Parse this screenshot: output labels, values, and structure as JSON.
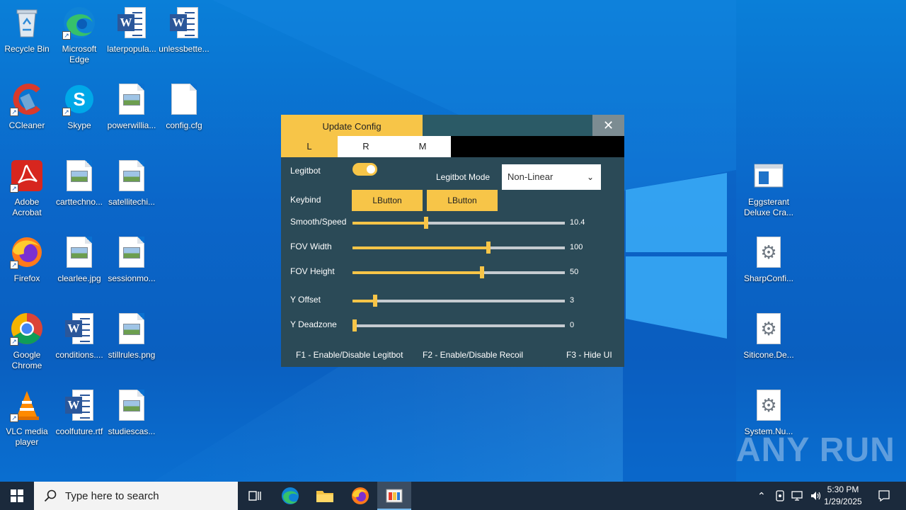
{
  "desktop": {
    "icons_left": [
      {
        "label": "Recycle Bin",
        "icon": "recycle-bin-icon"
      },
      {
        "label": "Microsoft Edge",
        "icon": "edge-icon"
      },
      {
        "label": "laterpopula...",
        "icon": "word-doc-icon"
      },
      {
        "label": "unlessbette...",
        "icon": "word-doc-icon"
      },
      {
        "label": "CCleaner",
        "icon": "ccleaner-icon"
      },
      {
        "label": "Skype",
        "icon": "skype-icon"
      },
      {
        "label": "powerwillia...",
        "icon": "image-file-icon"
      },
      {
        "label": "config.cfg",
        "icon": "blank-file-icon"
      },
      {
        "label": "Adobe Acrobat",
        "icon": "acrobat-icon"
      },
      {
        "label": "carttechno...",
        "icon": "image-file-icon"
      },
      {
        "label": "satellitechi...",
        "icon": "image-file-icon"
      },
      {
        "label": "Firefox",
        "icon": "firefox-icon"
      },
      {
        "label": "clearlee.jpg",
        "icon": "image-file-icon"
      },
      {
        "label": "sessionmo...",
        "icon": "image-file-icon"
      },
      {
        "label": "Google Chrome",
        "icon": "chrome-icon"
      },
      {
        "label": "conditions....",
        "icon": "word-doc-icon"
      },
      {
        "label": "stillrules.png",
        "icon": "image-file-icon"
      },
      {
        "label": "VLC media player",
        "icon": "vlc-icon"
      },
      {
        "label": "coolfuture.rtf",
        "icon": "word-doc-icon"
      },
      {
        "label": "studiescas...",
        "icon": "image-file-icon"
      }
    ],
    "icons_right": [
      {
        "label": "Eggsterant Deluxe Cra...",
        "icon": "app-window-icon"
      },
      {
        "label": "SharpConfi...",
        "icon": "settings-file-icon"
      },
      {
        "label": "Siticone.De...",
        "icon": "settings-file-icon"
      },
      {
        "label": "System.Nu...",
        "icon": "settings-file-icon"
      }
    ],
    "watermark": "ANY RUN"
  },
  "config_window": {
    "title": "Update Config",
    "close_glyph": "✕",
    "tabs": [
      "L",
      "R",
      "M"
    ],
    "active_tab": "L",
    "legitbot_label": "Legitbot",
    "legitbot_enabled": true,
    "legitbot_mode_label": "Legitbot Mode",
    "legitbot_mode_value": "Non-Linear",
    "keybind_label": "Keybind",
    "keybind_1": "LButton",
    "keybind_2": "LButton",
    "sliders": [
      {
        "label": "Smooth/Speed",
        "value": "10.4",
        "fraction": 0.345
      },
      {
        "label": "FOV Width",
        "value": "100",
        "fraction": 0.64
      },
      {
        "label": "FOV Height",
        "value": "50",
        "fraction": 0.61
      },
      {
        "label": "Y Offset",
        "value": "3",
        "fraction": 0.105
      },
      {
        "label": "Y Deadzone",
        "value": "0",
        "fraction": 0.01
      }
    ],
    "footer": {
      "f1": "F1 - Enable/Disable Legitbot",
      "f2": "F2 - Enable/Disable Recoil",
      "f3": "F3 - Hide UI"
    },
    "accent_color": "#f7c548",
    "panel_color": "#2b4a57"
  },
  "taskbar": {
    "search_placeholder": "Type here to search",
    "time": "5:30 PM",
    "date": "1/29/2025",
    "pinned": [
      "task-view-icon",
      "edge-icon",
      "file-explorer-icon",
      "firefox-icon",
      "config-app-icon"
    ]
  }
}
